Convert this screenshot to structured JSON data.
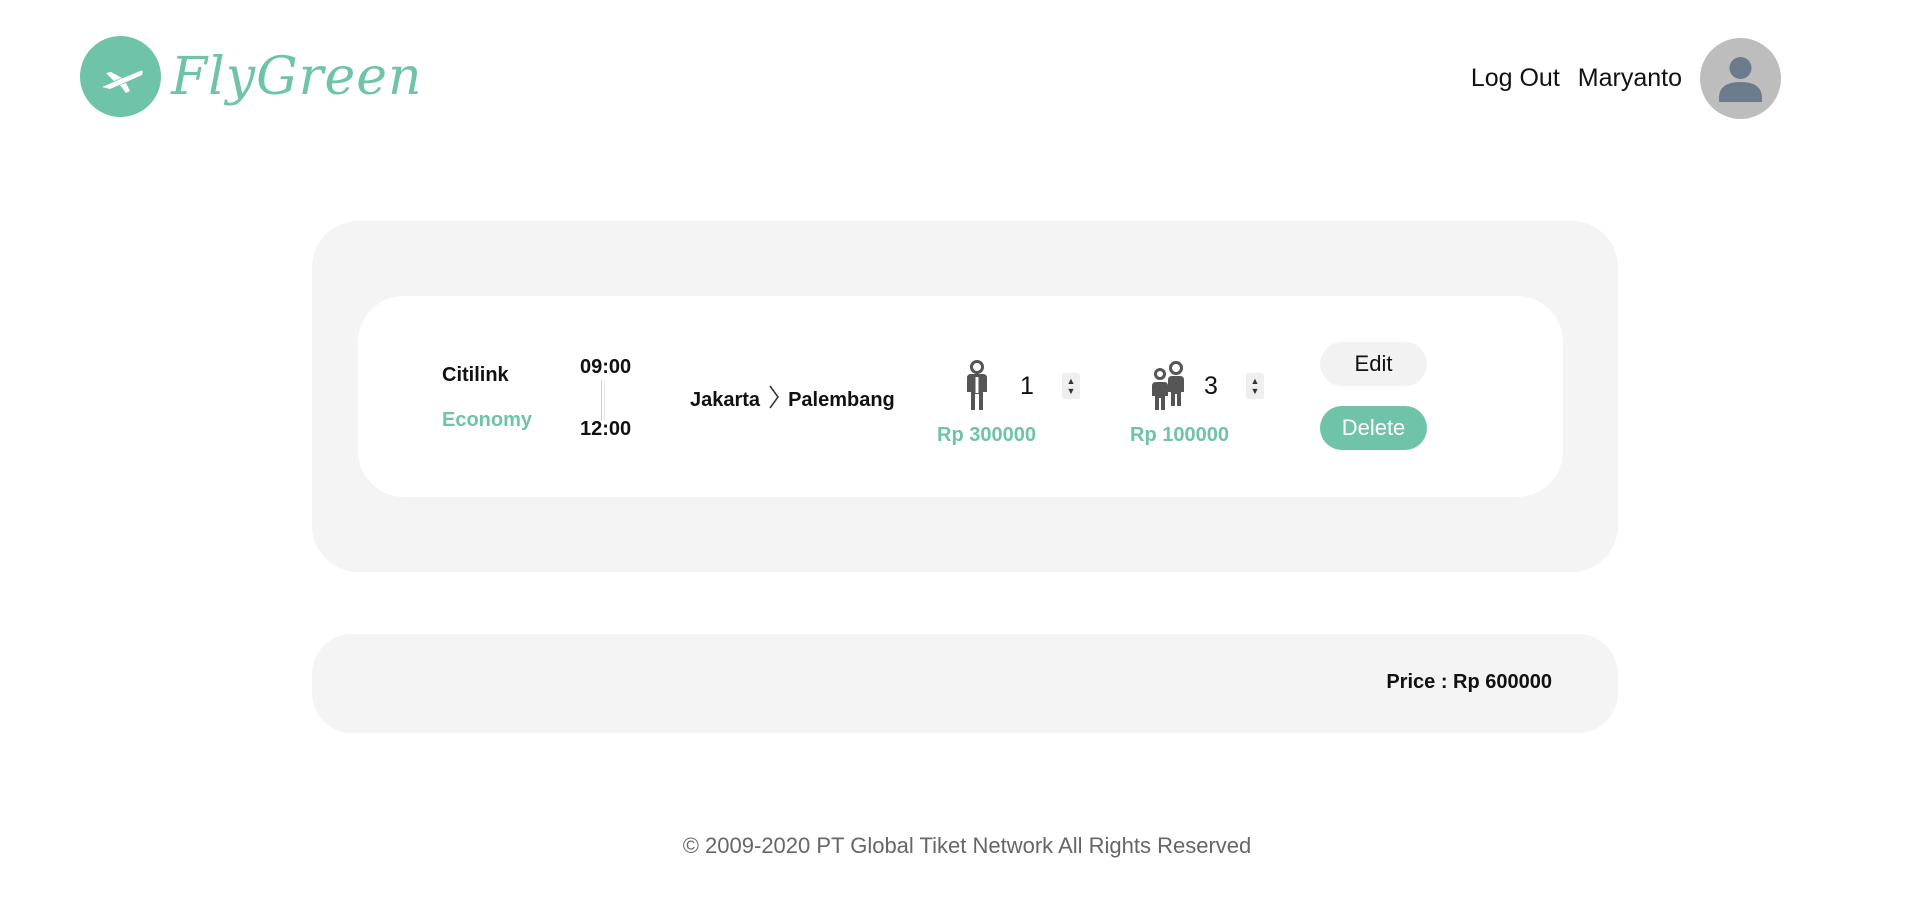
{
  "header": {
    "brand": "FlyGreen",
    "logout_label": "Log Out",
    "user_name": "Maryanto"
  },
  "booking": {
    "airline": "Citilink",
    "class": "Economy",
    "departure_time": "09:00",
    "arrival_time": "12:00",
    "origin": "Jakarta",
    "destination": "Palembang",
    "adult_count": "1",
    "adult_price": "Rp 300000",
    "child_count": "3",
    "child_price": "Rp 100000",
    "edit_label": "Edit",
    "delete_label": "Delete"
  },
  "summary": {
    "total_price": "Price : Rp 600000"
  },
  "footer": {
    "copyright": "© 2009-2020 PT Global Tiket Network All Rights Reserved"
  },
  "colors": {
    "accent": "#6fc3a8",
    "card_bg": "#f4f4f4",
    "avatar_bg": "#bdbdbd"
  },
  "icons": {
    "logo": "airplane-icon",
    "avatar": "user-silhouette-icon",
    "adult": "adult-person-icon",
    "child": "child-person-icon",
    "stepper": "stepper-arrows-icon",
    "route_separator": "chevron-right-icon"
  }
}
